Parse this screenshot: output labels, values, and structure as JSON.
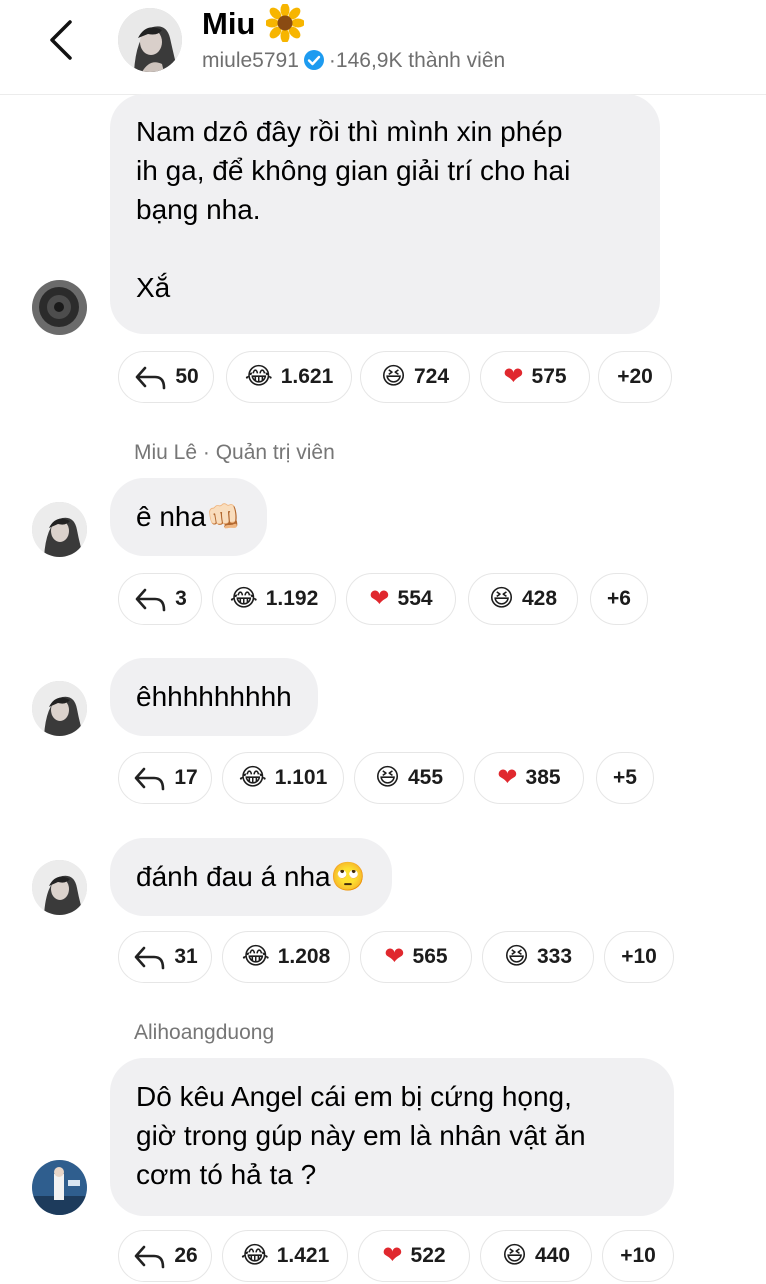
{
  "header": {
    "name": "Miu",
    "username": "miule5791",
    "members": "146,9K thành viên",
    "flower_icon": "sunflower-icon",
    "verified_color": "#1d9bf0"
  },
  "messages": [
    {
      "sender": "",
      "text": "Nam dzô đây rồi thì mình xin phép\nih ga, để không gian giải trí cho hai\nbạng nha.\n\nXắ",
      "reactions": [
        {
          "type": "reply",
          "count": "50"
        },
        {
          "type": "laugh-cry",
          "count": "1.621"
        },
        {
          "type": "grin-squint",
          "count": "724"
        },
        {
          "type": "heart",
          "count": "575"
        },
        {
          "type": "more",
          "count": "+20"
        }
      ]
    },
    {
      "sender": "Miu Lê · Quản trị viên",
      "text": "ê nha👊🏻",
      "reactions": [
        {
          "type": "reply",
          "count": "3"
        },
        {
          "type": "laugh-cry",
          "count": "1.192"
        },
        {
          "type": "heart",
          "count": "554"
        },
        {
          "type": "grin-squint",
          "count": "428"
        },
        {
          "type": "more",
          "count": "+6"
        }
      ]
    },
    {
      "sender": "",
      "text": "êhhhhhhhhh",
      "reactions": [
        {
          "type": "reply",
          "count": "17"
        },
        {
          "type": "laugh-cry",
          "count": "1.101"
        },
        {
          "type": "grin-squint",
          "count": "455"
        },
        {
          "type": "heart",
          "count": "385"
        },
        {
          "type": "more",
          "count": "+5"
        }
      ]
    },
    {
      "sender": "",
      "text": "đánh đau á nha🙄",
      "reactions": [
        {
          "type": "reply",
          "count": "31"
        },
        {
          "type": "laugh-cry",
          "count": "1.208"
        },
        {
          "type": "heart",
          "count": "565"
        },
        {
          "type": "grin-squint",
          "count": "333"
        },
        {
          "type": "more",
          "count": "+10"
        }
      ]
    },
    {
      "sender": "Alihoangduong",
      "text": "Dô kêu Angel cái em bị cứng họng,\ngiờ trong gúp này em là nhân vật ăn\ncơm tó hả ta ?",
      "reactions": [
        {
          "type": "reply",
          "count": "26"
        },
        {
          "type": "laugh-cry",
          "count": "1.421"
        },
        {
          "type": "heart",
          "count": "522"
        },
        {
          "type": "grin-squint",
          "count": "440"
        },
        {
          "type": "more",
          "count": "+10"
        }
      ]
    }
  ]
}
